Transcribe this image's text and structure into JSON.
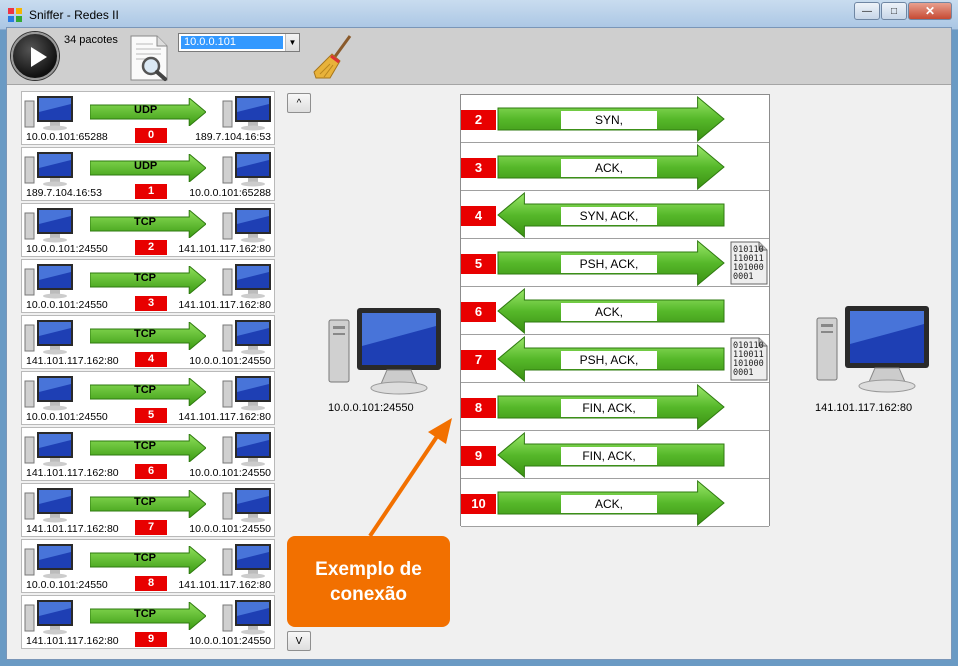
{
  "window": {
    "title": "Sniffer - Redes II"
  },
  "toolbar": {
    "packet_count": "34 pacotes",
    "ip_value": "10.0.0.101"
  },
  "packets": [
    {
      "proto": "UDP",
      "index": "0",
      "src": "10.0.0.101:65288",
      "dst": "189.7.104.16:53"
    },
    {
      "proto": "UDP",
      "index": "1",
      "src": "189.7.104.16:53",
      "dst": "10.0.0.101:65288"
    },
    {
      "proto": "TCP",
      "index": "2",
      "src": "10.0.0.101:24550",
      "dst": "141.101.117.162:80"
    },
    {
      "proto": "TCP",
      "index": "3",
      "src": "10.0.0.101:24550",
      "dst": "141.101.117.162:80"
    },
    {
      "proto": "TCP",
      "index": "4",
      "src": "141.101.117.162:80",
      "dst": "10.0.0.101:24550"
    },
    {
      "proto": "TCP",
      "index": "5",
      "src": "10.0.0.101:24550",
      "dst": "141.101.117.162:80"
    },
    {
      "proto": "TCP",
      "index": "6",
      "src": "141.101.117.162:80",
      "dst": "10.0.0.101:24550"
    },
    {
      "proto": "TCP",
      "index": "7",
      "src": "141.101.117.162:80",
      "dst": "10.0.0.101:24550"
    },
    {
      "proto": "TCP",
      "index": "8",
      "src": "10.0.0.101:24550",
      "dst": "141.101.117.162:80"
    },
    {
      "proto": "TCP",
      "index": "9",
      "src": "141.101.117.162:80",
      "dst": "10.0.0.101:24550"
    }
  ],
  "scroll": {
    "up": "^",
    "down": "V"
  },
  "connection": {
    "client": "10.0.0.101:24550",
    "server": "141.101.117.162:80",
    "rows": [
      {
        "index": "2",
        "label": "SYN,",
        "direction": "right",
        "data": false
      },
      {
        "index": "3",
        "label": "ACK,",
        "direction": "right",
        "data": false
      },
      {
        "index": "4",
        "label": "SYN, ACK,",
        "direction": "left",
        "data": false
      },
      {
        "index": "5",
        "label": "PSH, ACK,",
        "direction": "right",
        "data": true
      },
      {
        "index": "6",
        "label": "ACK,",
        "direction": "left",
        "data": false
      },
      {
        "index": "7",
        "label": "PSH, ACK,",
        "direction": "left",
        "data": true
      },
      {
        "index": "8",
        "label": "FIN, ACK,",
        "direction": "right",
        "data": false
      },
      {
        "index": "9",
        "label": "FIN, ACK,",
        "direction": "left",
        "data": false
      },
      {
        "index": "10",
        "label": "ACK,",
        "direction": "right",
        "data": false
      }
    ],
    "binary_lines": [
      "010110",
      "110011",
      "101000",
      "0001"
    ]
  },
  "callout": {
    "text": "Exemplo de conexão"
  },
  "colors": {
    "accent_red": "#e80000",
    "arrow_green": "#4caf1a",
    "callout_orange": "#f27000"
  }
}
